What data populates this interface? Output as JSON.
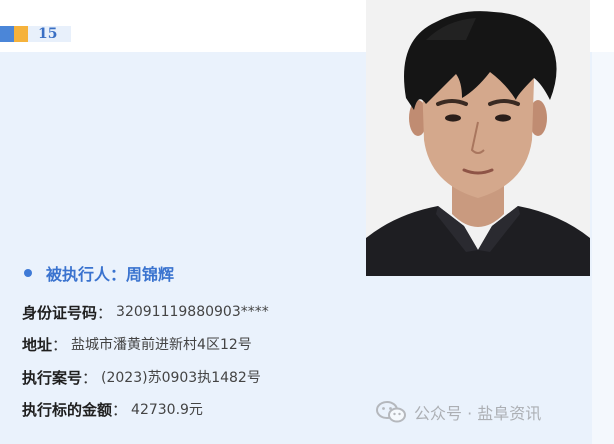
{
  "index_marker": {
    "number": "15",
    "colors": {
      "blue": "#4b86d8",
      "yellow": "#f5b23c"
    }
  },
  "photo": {
    "icon": "portrait-photo"
  },
  "person": {
    "label": "被执行人：",
    "name": "周锦辉"
  },
  "fields": [
    {
      "label": "身份证号码",
      "colon": "：",
      "value": "32091119880903****"
    },
    {
      "label": "地址",
      "colon": "：",
      "value": "盐城市潘黄前进新村4区12号"
    },
    {
      "label": "执行案号",
      "colon": "：",
      "value": "(2023)苏0903执1482号"
    },
    {
      "label": "执行标的金额",
      "colon": "：",
      "value": "42730.9元"
    }
  ],
  "watermark": {
    "icon": "wechat-icon",
    "text": "公众号 · 盐阜资讯"
  },
  "colors": {
    "accent": "#3a73cf",
    "panel_background": "#eaf2fc"
  }
}
